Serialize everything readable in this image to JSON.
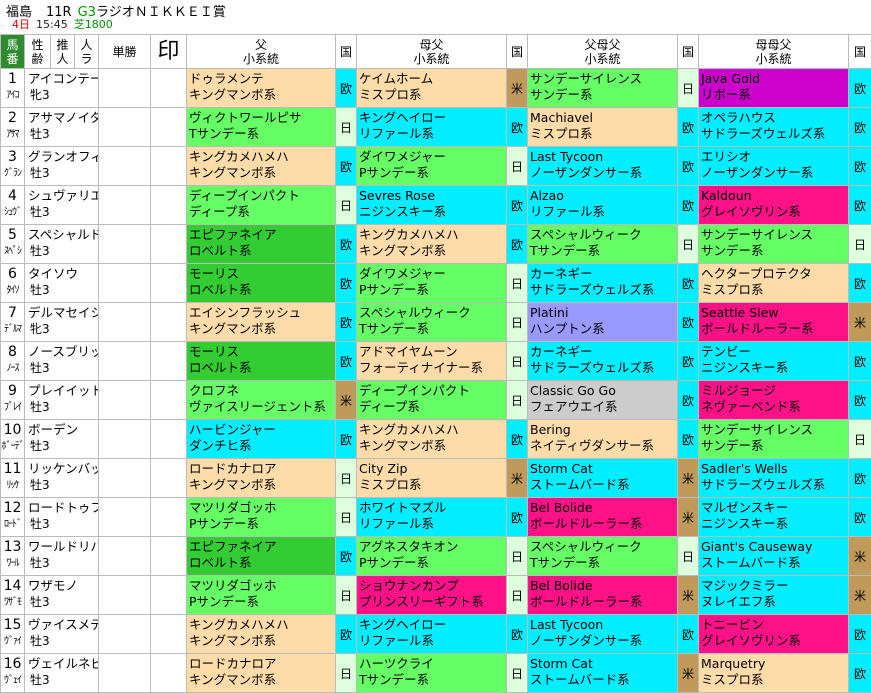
{
  "header": {
    "venue": "福島",
    "race_no": "11R",
    "grade": "G3",
    "race_name": "ラジオＮＩＫＫＥＩ賞",
    "day": "4日",
    "time": "15:45",
    "course": "芝1800"
  },
  "columns": {
    "umaban_1": "馬",
    "umaban_2": "番",
    "sexage_1": "性",
    "sexage_2": "齢",
    "suisho_1": "推",
    "suisho_2": "人",
    "ninki_1": "人",
    "ninki_2": "ラ",
    "tansho": "単勝",
    "mark": "印",
    "sire_1": "父",
    "sire_2": "小系統",
    "country": "国",
    "dam_sire_1": "母父",
    "dam_sire_2": "小系統",
    "sire_of_dam_sire_1": "父母父",
    "sire_of_dam_sire_2": "小系統",
    "dam_dam_sire_1": "母母父",
    "dam_dam_sire_2": "小系統"
  },
  "colors": {
    "peach": "#fddcaa",
    "red": "#ff1188",
    "light_green": "#66ff66",
    "dark_green": "#33cc33",
    "cyan": "#00eeff",
    "lavender": "#9999ff",
    "gray": "#cccccc",
    "purple": "#cc00cc",
    "country_euro": "#00eeff",
    "country_jp": "#ddffdd",
    "country_us": "#c09a5a",
    "header_green": "#2e8b2e"
  },
  "horses": [
    {
      "num": "1",
      "abbr": "ｱｲｺ",
      "name": "アイコンテーラー",
      "sex": "牝3",
      "f": [
        "ドゥラメンテ",
        "キングマンボ系"
      ],
      "f_c": "peach",
      "f_k": "欧",
      "mf": [
        "ケイムホーム",
        "ミスプロ系"
      ],
      "mf_c": "peach",
      "mf_k": "米",
      "fmf": [
        "サンデーサイレンス",
        "サンデー系"
      ],
      "fmf_c": "light_green",
      "fmf_k": "日",
      "mmf": [
        "Java Gold",
        "リボー系"
      ],
      "mmf_c": "purple",
      "mmf_k": "欧"
    },
    {
      "num": "2",
      "abbr": "ｱｻﾏ",
      "name": "アサマノイタズラ",
      "sex": "牡3",
      "f": [
        "ヴィクトワールピサ",
        "Tサンデー系"
      ],
      "f_c": "light_green",
      "f_k": "日",
      "mf": [
        "キングヘイロー",
        "リファール系"
      ],
      "mf_c": "cyan",
      "mf_k": "欧",
      "fmf": [
        "Machiavel",
        "ミスプロ系"
      ],
      "fmf_c": "peach",
      "fmf_k": "欧",
      "mmf": [
        "オペラハウス",
        "サドラーズウェルズ系"
      ],
      "mmf_c": "cyan",
      "mmf_k": "欧"
    },
    {
      "num": "3",
      "abbr": "ｸﾞﾗﾝ",
      "name": "グランオフィシエ",
      "sex": "牡3",
      "f": [
        "キングカメハメハ",
        "キングマンボ系"
      ],
      "f_c": "peach",
      "f_k": "欧",
      "mf": [
        "ダイワメジャー",
        "Pサンデー系"
      ],
      "mf_c": "light_green",
      "mf_k": "日",
      "fmf": [
        "Last Tycoon",
        "ノーザンダンサー系"
      ],
      "fmf_c": "cyan",
      "fmf_k": "欧",
      "mmf": [
        "エリシオ",
        "ノーザンダンサー系"
      ],
      "mmf_c": "cyan",
      "mmf_k": "欧"
    },
    {
      "num": "4",
      "abbr": "ｼｭｳﾞ",
      "name": "シュヴァリエローズ",
      "sex": "牡3",
      "f": [
        "ディープインパクト",
        "ディープ系"
      ],
      "f_c": "light_green",
      "f_k": "日",
      "mf": [
        "Sevres Rose",
        "ニジンスキー系"
      ],
      "mf_c": "cyan",
      "mf_k": "欧",
      "fmf": [
        "Alzao",
        "リファール系"
      ],
      "fmf_c": "cyan",
      "fmf_k": "欧",
      "mmf": [
        "Kaldoun",
        "グレイソヴリン系"
      ],
      "mmf_c": "red",
      "mmf_k": "欧"
    },
    {
      "num": "5",
      "abbr": "ｽﾍﾟｼ",
      "name": "スペシャルドラマ",
      "sex": "牡3",
      "f": [
        "エピファネイア",
        "ロベルト系"
      ],
      "f_c": "dark_green",
      "f_k": "欧",
      "mf": [
        "キングカメハメハ",
        "キングマンボ系"
      ],
      "mf_c": "peach",
      "mf_k": "欧",
      "fmf": [
        "スペシャルウィーク",
        "Tサンデー系"
      ],
      "fmf_c": "light_green",
      "fmf_k": "日",
      "mmf": [
        "サンデーサイレンス",
        "サンデー系"
      ],
      "mmf_c": "light_green",
      "mmf_k": "日"
    },
    {
      "num": "6",
      "abbr": "ﾀｲｿ",
      "name": "タイソウ",
      "sex": "牡3",
      "f": [
        "モーリス",
        "ロベルト系"
      ],
      "f_c": "dark_green",
      "f_k": "欧",
      "mf": [
        "ダイワメジャー",
        "Pサンデー系"
      ],
      "mf_c": "light_green",
      "mf_k": "日",
      "fmf": [
        "カーネギー",
        "サドラーズウェルズ系"
      ],
      "fmf_c": "cyan",
      "fmf_k": "欧",
      "mmf": [
        "ヘクタープロテクタ",
        "ミスプロ系"
      ],
      "mmf_c": "peach",
      "mmf_k": "欧"
    },
    {
      "num": "7",
      "abbr": "ﾃﾞﾙﾏ",
      "name": "デルマセイシ",
      "sex": "牝3",
      "f": [
        "エイシンフラッシュ",
        "キングマンボ系"
      ],
      "f_c": "peach",
      "f_k": "欧",
      "mf": [
        "スペシャルウィーク",
        "Tサンデー系"
      ],
      "mf_c": "light_green",
      "mf_k": "日",
      "fmf": [
        "Platini",
        "ハンプトン系"
      ],
      "fmf_c": "lavender",
      "fmf_k": "欧",
      "mmf": [
        "Seattle Slew",
        "ボールドルーラー系"
      ],
      "mmf_c": "red",
      "mmf_k": "米"
    },
    {
      "num": "8",
      "abbr": "ﾉｰｽ",
      "name": "ノースブリッジ",
      "sex": "牡3",
      "f": [
        "モーリス",
        "ロベルト系"
      ],
      "f_c": "dark_green",
      "f_k": "欧",
      "mf": [
        "アドマイヤムーン",
        "フォーティナイナー系"
      ],
      "mf_c": "peach",
      "mf_k": "日",
      "fmf": [
        "カーネギー",
        "サドラーズウェルズ系"
      ],
      "fmf_c": "cyan",
      "fmf_k": "欧",
      "mmf": [
        "テンビー",
        "ニジンスキー系"
      ],
      "mmf_c": "cyan",
      "mmf_k": "欧"
    },
    {
      "num": "9",
      "abbr": "ﾌﾟﾚｲ",
      "name": "プレイイットサム",
      "sex": "牡3",
      "f": [
        "クロフネ",
        "ヴァイスリージェント系"
      ],
      "f_c": "light_green",
      "f_k": "米",
      "mf": [
        "ディープインパクト",
        "ディープ系"
      ],
      "mf_c": "light_green",
      "mf_k": "日",
      "fmf": [
        "Classic Go Go",
        "フェアウエイ系"
      ],
      "fmf_c": "gray",
      "fmf_k": "欧",
      "mmf": [
        "ミルジョージ",
        "ネヴァーベンド系"
      ],
      "mmf_c": "red",
      "mmf_k": "欧"
    },
    {
      "num": "10",
      "abbr": "ﾎﾞｰﾃﾞ",
      "name": "ボーデン",
      "sex": "牡3",
      "f": [
        "ハービンジャー",
        "ダンチヒ系"
      ],
      "f_c": "cyan",
      "f_k": "欧",
      "mf": [
        "キングカメハメハ",
        "キングマンボ系"
      ],
      "mf_c": "peach",
      "mf_k": "欧",
      "fmf": [
        "Bering",
        "ネイティヴダンサー系"
      ],
      "fmf_c": "peach",
      "fmf_k": "欧",
      "mmf": [
        "サンデーサイレンス",
        "サンデー系"
      ],
      "mmf_c": "light_green",
      "mmf_k": "日"
    },
    {
      "num": "11",
      "abbr": "ﾘｯｹ",
      "name": "リッケンバッカー",
      "sex": "牡3",
      "f": [
        "ロードカナロア",
        "キングマンボ系"
      ],
      "f_c": "peach",
      "f_k": "日",
      "mf": [
        "City Zip",
        "ミスプロ系"
      ],
      "mf_c": "peach",
      "mf_k": "米",
      "fmf": [
        "Storm Cat",
        "ストームバード系"
      ],
      "fmf_c": "cyan",
      "fmf_k": "米",
      "mmf": [
        "Sadler's Wells",
        "サドラーズウェルズ系"
      ],
      "mmf_c": "cyan",
      "mmf_k": "欧"
    },
    {
      "num": "12",
      "abbr": "ﾛｰﾄﾞ",
      "name": "ロードトゥフェイム",
      "sex": "牡3",
      "f": [
        "マツリダゴッホ",
        "Pサンデー系"
      ],
      "f_c": "light_green",
      "f_k": "日",
      "mf": [
        "ホワイトマズル",
        "リファール系"
      ],
      "mf_c": "cyan",
      "mf_k": "欧",
      "fmf": [
        "Bel Bolide",
        "ボールドルーラー系"
      ],
      "fmf_c": "red",
      "fmf_k": "米",
      "mmf": [
        "マルゼンスキー",
        "ニジンスキー系"
      ],
      "mmf_c": "cyan",
      "mmf_k": "欧"
    },
    {
      "num": "13",
      "abbr": "ﾜｰﾙ",
      "name": "ワールドリバイバル",
      "sex": "牡3",
      "f": [
        "エピファネイア",
        "ロベルト系"
      ],
      "f_c": "dark_green",
      "f_k": "欧",
      "mf": [
        "アグネスタキオン",
        "Pサンデー系"
      ],
      "mf_c": "light_green",
      "mf_k": "日",
      "fmf": [
        "スペシャルウィーク",
        "Tサンデー系"
      ],
      "fmf_c": "light_green",
      "fmf_k": "日",
      "mmf": [
        "Giant's Causeway",
        "ストームバード系"
      ],
      "mmf_c": "cyan",
      "mmf_k": "米"
    },
    {
      "num": "14",
      "abbr": "ﾜｻﾞﾓ",
      "name": "ワザモノ",
      "sex": "牡3",
      "f": [
        "マツリダゴッホ",
        "Pサンデー系"
      ],
      "f_c": "light_green",
      "f_k": "日",
      "mf": [
        "ショウナンカンプ",
        "プリンスリーギフト系"
      ],
      "mf_c": "red",
      "mf_k": "日",
      "fmf": [
        "Bel Bolide",
        "ボールドルーラー系"
      ],
      "fmf_c": "red",
      "fmf_k": "米",
      "mmf": [
        "マジックミラー",
        "ヌレイエフ系"
      ],
      "mmf_c": "cyan",
      "mmf_k": "米"
    },
    {
      "num": "15",
      "abbr": "ｳﾞｧｲ",
      "name": "ヴァイスメテオール",
      "sex": "牡3",
      "f": [
        "キングカメハメハ",
        "キングマンボ系"
      ],
      "f_c": "peach",
      "f_k": "欧",
      "mf": [
        "キングヘイロー",
        "リファール系"
      ],
      "mf_c": "cyan",
      "mf_k": "欧",
      "fmf": [
        "Last Tycoon",
        "ノーザンダンサー系"
      ],
      "fmf_c": "cyan",
      "fmf_k": "欧",
      "mmf": [
        "トニービン",
        "グレイソヴリン系"
      ],
      "mmf_c": "red",
      "mmf_k": "欧"
    },
    {
      "num": "16",
      "abbr": "ｳﾞｪｲ",
      "name": "ヴェイルネビュラ",
      "sex": "牡3",
      "f": [
        "ロードカナロア",
        "キングマンボ系"
      ],
      "f_c": "peach",
      "f_k": "日",
      "mf": [
        "ハーツクライ",
        "Tサンデー系"
      ],
      "mf_c": "light_green",
      "mf_k": "日",
      "fmf": [
        "Storm Cat",
        "ストームバード系"
      ],
      "fmf_c": "cyan",
      "fmf_k": "米",
      "mmf": [
        "Marquetry",
        "ミスプロ系"
      ],
      "mmf_c": "peach",
      "mmf_k": "欧"
    }
  ]
}
